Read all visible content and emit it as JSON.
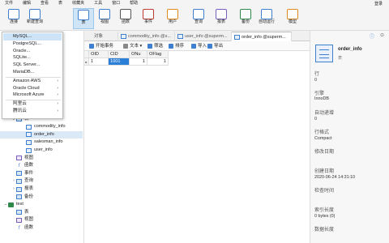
{
  "menubar": {
    "items": [
      "文件",
      "编辑",
      "查看",
      "表",
      "收藏夹",
      "工具",
      "窗口",
      "帮助"
    ],
    "login": "登录"
  },
  "toolbar": {
    "items": [
      {
        "label": "连接",
        "icon": "connection-icon"
      },
      {
        "label": "新建查询",
        "icon": "new-query-icon"
      },
      {
        "label": "表",
        "icon": "table-icon"
      },
      {
        "label": "视图",
        "icon": "view-icon"
      },
      {
        "label": "函数",
        "icon": "function-icon"
      },
      {
        "label": "事件",
        "icon": "event-icon"
      },
      {
        "label": "用户",
        "icon": "user-icon"
      },
      {
        "label": "查询",
        "icon": "query-icon"
      },
      {
        "label": "报表",
        "icon": "report-icon"
      },
      {
        "label": "备份",
        "icon": "backup-icon"
      },
      {
        "label": "自动运行",
        "icon": "automation-icon"
      },
      {
        "label": "模型",
        "icon": "model-icon"
      }
    ],
    "active_index": 2
  },
  "dropdown": {
    "items": [
      {
        "label": "MySQL...",
        "arrow": false,
        "highlight": true
      },
      {
        "label": "PostgreSQL...",
        "arrow": false
      },
      {
        "label": "Oracle...",
        "arrow": false
      },
      {
        "label": "SQLite...",
        "arrow": false
      },
      {
        "label": "SQL Server...",
        "arrow": false
      },
      {
        "label": "MariaDB...",
        "arrow": false
      },
      {
        "label": "Amazon AWS",
        "arrow": true
      },
      {
        "label": "Oracle Cloud",
        "arrow": true
      },
      {
        "label": "Microsoft Azure",
        "arrow": true
      },
      {
        "label": "阿里云",
        "arrow": true
      },
      {
        "label": "腾讯云",
        "arrow": true
      }
    ],
    "arrow_glyph": "›"
  },
  "tree": {
    "partial_label": "ma",
    "rows": [
      {
        "label": "supermaket_system",
        "type": "db",
        "expand": "v",
        "indent": 4
      },
      {
        "label": "表",
        "type": "folder",
        "expand": "v",
        "indent": 14
      },
      {
        "label": "commodity_info",
        "type": "table",
        "expand": "",
        "indent": 26
      },
      {
        "label": "order_info",
        "type": "table",
        "expand": "",
        "indent": 26,
        "selected": true
      },
      {
        "label": "salesman_info",
        "type": "table",
        "expand": "",
        "indent": 26
      },
      {
        "label": "user_info",
        "type": "table",
        "expand": "",
        "indent": 26
      },
      {
        "label": "视图",
        "type": "view",
        "expand": "",
        "indent": 14
      },
      {
        "label": "函数",
        "type": "func",
        "expand": "",
        "indent": 14
      },
      {
        "label": "事件",
        "type": "folder",
        "expand": "",
        "indent": 14
      },
      {
        "label": "查询",
        "type": "folder",
        "expand": ">",
        "indent": 14
      },
      {
        "label": "报表",
        "type": "folder",
        "expand": ">",
        "indent": 14
      },
      {
        "label": "备份",
        "type": "folder",
        "expand": "",
        "indent": 14
      },
      {
        "label": "test",
        "type": "db",
        "expand": "v",
        "indent": 4
      },
      {
        "label": "表",
        "type": "folder",
        "expand": "",
        "indent": 14
      },
      {
        "label": "视图",
        "type": "view",
        "expand": "",
        "indent": 14
      },
      {
        "label": "函数",
        "type": "func",
        "expand": "",
        "indent": 14
      }
    ]
  },
  "tabs": [
    {
      "label": "对象",
      "active": false,
      "icon": false
    },
    {
      "label": "commodity_info @s...",
      "active": false,
      "icon": true
    },
    {
      "label": "user_info @superm...",
      "active": false,
      "icon": true
    },
    {
      "label": "order_info @superm...",
      "active": true,
      "icon": true
    }
  ],
  "data_toolbar": [
    {
      "label": "开始事务",
      "color": "#3f7fcf"
    },
    {
      "label": "文本 ▾",
      "color": "#888888"
    },
    {
      "label": "筛选",
      "color": "#3f7fcf"
    },
    {
      "label": "排序",
      "color": "#3f7fcf"
    },
    {
      "label": "导入",
      "color": "#3f7fcf"
    },
    {
      "label": "导出",
      "color": "#3f7fcf"
    }
  ],
  "grid": {
    "columns": [
      "OID",
      "CID",
      "ONu",
      "OFlag"
    ],
    "rows": [
      [
        "1",
        "1001",
        "1",
        "1"
      ]
    ],
    "selected_col": 1
  },
  "info": {
    "name": "order_info",
    "subtitle": "表",
    "fields": [
      {
        "label": "行",
        "value": "0"
      },
      {
        "label": "引擎",
        "value": "InnoDB"
      },
      {
        "label": "自动递增",
        "value": "0"
      },
      {
        "label": "行格式",
        "value": "Compact"
      },
      {
        "label": "修改日期",
        "value": ""
      },
      {
        "label": "创建日期",
        "value": "2020-06-24 14:31:10"
      },
      {
        "label": "检查时间",
        "value": ""
      },
      {
        "label": "索引长度",
        "value": "0 bytes (0)"
      },
      {
        "label": "数据长度",
        "value": ""
      }
    ]
  },
  "colors": {
    "accent": "#2b7fd7",
    "selection": "#dbe8f6",
    "db_icon": "#2f8a4a"
  }
}
